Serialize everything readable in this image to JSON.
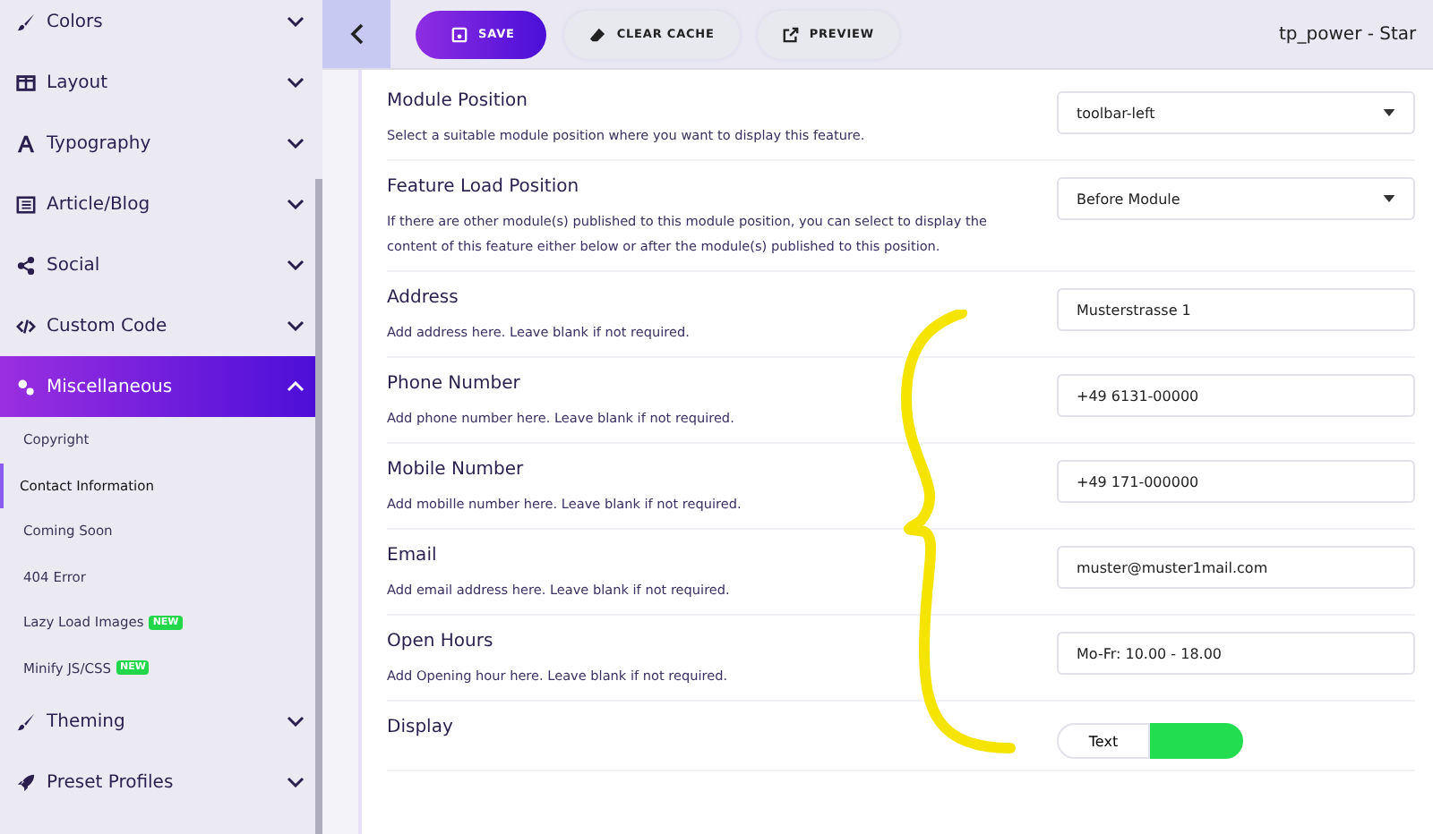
{
  "sidebar": {
    "items": [
      {
        "label": "Colors",
        "expanded": false,
        "selected": false
      },
      {
        "label": "Layout",
        "expanded": false,
        "selected": false
      },
      {
        "label": "Typography",
        "expanded": false,
        "selected": false
      },
      {
        "label": "Article/Blog",
        "expanded": false,
        "selected": false
      },
      {
        "label": "Social",
        "expanded": false,
        "selected": false
      },
      {
        "label": "Custom Code",
        "expanded": false,
        "selected": false
      },
      {
        "label": "Miscellaneous",
        "expanded": true,
        "selected": true,
        "children": [
          {
            "label": "Copyright",
            "selected": false
          },
          {
            "label": "Contact Information",
            "selected": true
          },
          {
            "label": "Coming Soon",
            "selected": false
          },
          {
            "label": "404 Error",
            "selected": false
          },
          {
            "label": "Lazy Load Images",
            "badge": "NEW",
            "selected": false
          },
          {
            "label": "Minify JS/CSS",
            "badge": "NEW",
            "selected": false
          }
        ]
      },
      {
        "label": "Theming",
        "expanded": false,
        "selected": false
      },
      {
        "label": "Preset Profiles",
        "expanded": false,
        "selected": false
      }
    ]
  },
  "toolbar": {
    "buttons": [
      {
        "label": "SAVE",
        "kind": "primary"
      },
      {
        "label": "CLEAR CACHE",
        "kind": "secondary"
      },
      {
        "label": "PREVIEW",
        "kind": "secondary"
      }
    ],
    "title": "tp_power - Star"
  },
  "settings": [
    {
      "kind": "select",
      "label": "Module Position",
      "description": "Select a suitable module position where you want to display this feature.",
      "value": "toolbar-left"
    },
    {
      "kind": "select",
      "label": "Feature Load Position",
      "description": "If there are other module(s) published to this module position, you can select to display the content of this feature either below or after the module(s) published to this position.",
      "value": "Before Module"
    },
    {
      "kind": "text",
      "label": "Address",
      "description": "Add address here. Leave blank if not required.",
      "value": "Musterstrasse 1"
    },
    {
      "kind": "text",
      "label": "Phone Number",
      "description": "Add phone number here. Leave blank if not required.",
      "value": "+49 6131-00000"
    },
    {
      "kind": "text",
      "label": "Mobile Number",
      "description": "Add mobille number here. Leave blank if not required.",
      "value": "+49 171-000000"
    },
    {
      "kind": "text",
      "label": "Email",
      "description": "Add email address here. Leave blank if not required.",
      "value": "muster@muster1mail.com"
    },
    {
      "kind": "text",
      "label": "Open Hours",
      "description": "Add Opening hour here. Leave blank if not required.",
      "value": "Mo-Fr: 10.00 - 18.00"
    },
    {
      "kind": "toggle",
      "label": "Display",
      "options": [
        {
          "label": "Text",
          "selected": false
        },
        {
          "selected": true
        }
      ]
    }
  ]
}
